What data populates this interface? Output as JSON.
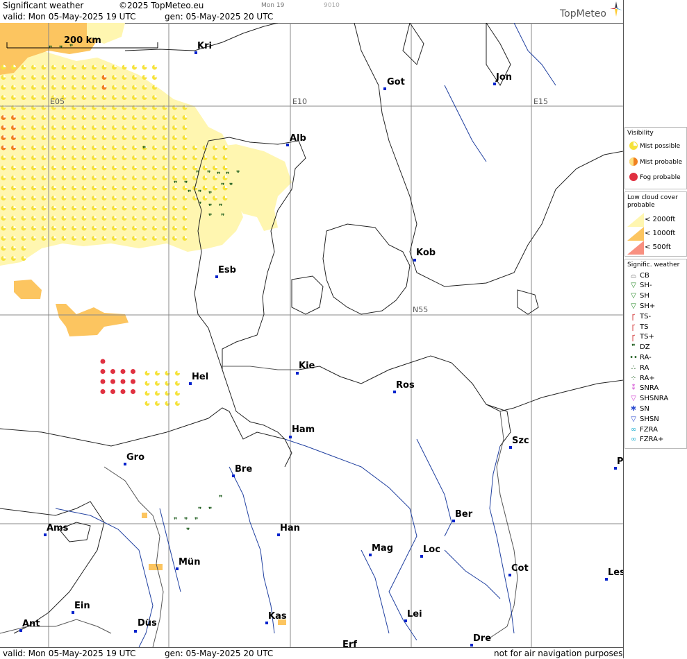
{
  "header": {
    "title": "Significant weather",
    "copyright": "©2025 TopMeteo.eu",
    "day_code": "Mon 19",
    "code": "9010",
    "valid": "valid:  Mon  05-May-2025  19 UTC",
    "gen": "gen: 05-May-2025 20 UTC",
    "logo": "TopMeteo"
  },
  "footer": {
    "valid": "valid:  Mon  05-May-2025  19 UTC",
    "gen": "gen: 05-May-2025 20 UTC",
    "disclaimer": "not for air navigation purposes"
  },
  "scale": {
    "label": "200 km"
  },
  "grid_labels": {
    "e05": "E05",
    "e10": "E10",
    "e15": "E15",
    "n55": "N55"
  },
  "cities": {
    "kri": "Kri",
    "got": "Got",
    "jon": "Jon",
    "alb": "Alb",
    "kob": "Kob",
    "esb": "Esb",
    "kie": "Kie",
    "hel": "Hel",
    "ros": "Ros",
    "ham": "Ham",
    "szc": "Szc",
    "gro": "Gro",
    "bre": "Bre",
    "p": "P",
    "ams": "Ams",
    "han": "Han",
    "ber": "Ber",
    "mag": "Mag",
    "loc": "Loc",
    "mun": "Mün",
    "cot": "Cot",
    "les": "Les",
    "ein": "Ein",
    "ant": "Ant",
    "dus": "Düs",
    "kas": "Kas",
    "lei": "Lei",
    "dre": "Dre",
    "erf": "Erf"
  },
  "legend": {
    "visibility": {
      "title": "Visibility",
      "items": [
        "Mist possible",
        "Mist probable",
        "Fog probable"
      ]
    },
    "low_cloud": {
      "title": "Low cloud cover probable",
      "items": [
        "< 2000ft",
        "< 1000ft",
        "<   500ft"
      ]
    },
    "signif": {
      "title": "Signific. weather",
      "items": [
        "CB",
        "SH-",
        "SH",
        "SH+",
        "TS-",
        "TS",
        "TS+",
        "DZ",
        "RA-",
        "RA",
        "RA+",
        "SNRA",
        "SHSNRA",
        "SN",
        "SHSN",
        "FZRA",
        "FZRA+"
      ]
    }
  },
  "colors": {
    "mist_possible": "#f5e23a",
    "mist_probable": "#f08020",
    "fog_probable": "#e03040",
    "cloud_2000": "#fff6b0",
    "cloud_1000": "#fcc560",
    "cloud_500": "#f89080",
    "coast": "#222222",
    "river": "#2040a0",
    "grid": "#888888",
    "city_dot": "#0022cc"
  }
}
